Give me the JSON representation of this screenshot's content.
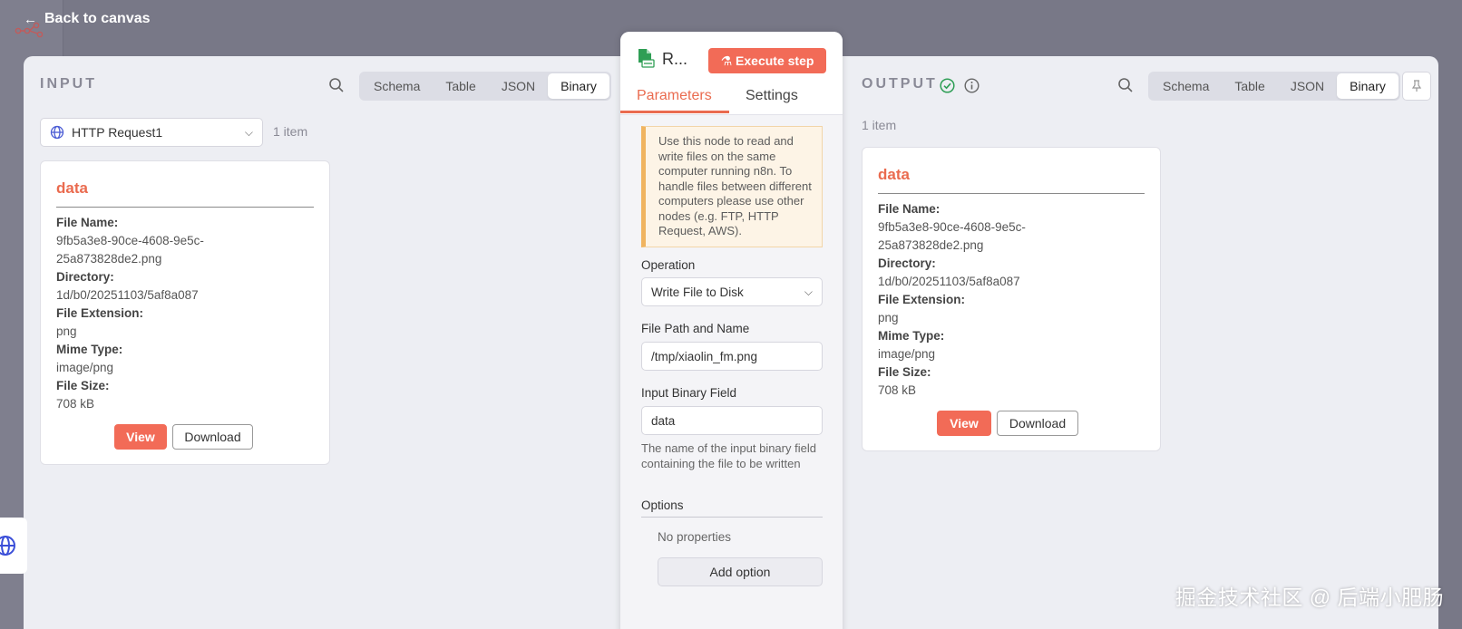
{
  "header": {
    "back_label": "Back to canvas"
  },
  "input": {
    "title": "INPUT",
    "tabs": [
      "Schema",
      "Table",
      "JSON",
      "Binary"
    ],
    "active_tab": "Binary",
    "node_select": "HTTP Request1",
    "item_count": "1 item",
    "card": {
      "title": "data",
      "fields": [
        {
          "key": "File Name:",
          "value": "9fb5a3e8-90ce-4608-9e5c-25a873828de2.png"
        },
        {
          "key": "Directory:",
          "value": "1d/b0/20251103/5af8a087"
        },
        {
          "key": "File Extension:",
          "value": "png"
        },
        {
          "key": "Mime Type:",
          "value": "image/png"
        },
        {
          "key": "File Size:",
          "value": "708 kB"
        }
      ],
      "view_label": "View",
      "download_label": "Download"
    }
  },
  "node": {
    "name": "R...",
    "execute_label": "Execute step",
    "tabs": {
      "parameters": "Parameters",
      "settings": "Settings"
    },
    "notice": "Use this node to read and write files on the same computer running n8n. To handle files between different computers please use other nodes (e.g. FTP, HTTP Request, AWS).",
    "operation_label": "Operation",
    "operation_value": "Write File to Disk",
    "path_label": "File Path and Name",
    "path_value": "/tmp/xiaolin_fm.png",
    "binary_label": "Input Binary Field",
    "binary_value": "data",
    "binary_hint": "The name of the input binary field containing the file to be written",
    "options_label": "Options",
    "no_properties": "No properties",
    "add_option_label": "Add option"
  },
  "output": {
    "title": "OUTPUT",
    "tabs": [
      "Schema",
      "Table",
      "JSON",
      "Binary"
    ],
    "active_tab": "Binary",
    "item_count": "1 item",
    "card": {
      "title": "data",
      "fields": [
        {
          "key": "File Name:",
          "value": "9fb5a3e8-90ce-4608-9e5c-25a873828de2.png"
        },
        {
          "key": "Directory:",
          "value": "1d/b0/20251103/5af8a087"
        },
        {
          "key": "File Extension:",
          "value": "png"
        },
        {
          "key": "Mime Type:",
          "value": "image/png"
        },
        {
          "key": "File Size:",
          "value": "708 kB"
        }
      ],
      "view_label": "View",
      "download_label": "Download"
    }
  },
  "watermark": "掘金技术社区 @ 后端小肥肠",
  "colors": {
    "accent": "#f26b57",
    "success": "#2e9e55",
    "panel_bg": "#edeef3"
  }
}
